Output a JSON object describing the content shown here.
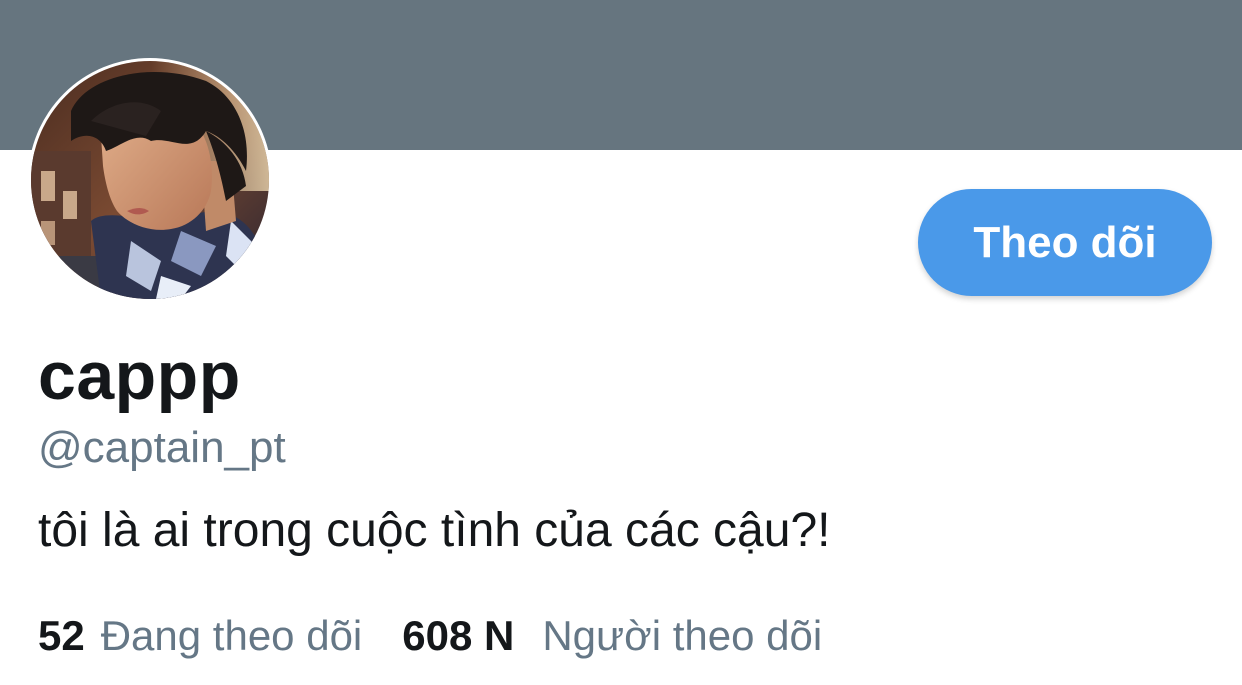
{
  "header": {
    "banner_color": "#66757f"
  },
  "profile": {
    "avatar_icon": "profile-photo",
    "display_name": "cappp",
    "handle": "@captain_pt",
    "bio": "tôi là ai trong cuộc tình của các cậu?!"
  },
  "actions": {
    "follow_label": "Theo dõi",
    "follow_color": "#4a99e9"
  },
  "stats": {
    "following_count": "52",
    "following_label": "Đang theo dõi",
    "followers_count": "608 N",
    "followers_label": "Người theo dõi"
  }
}
